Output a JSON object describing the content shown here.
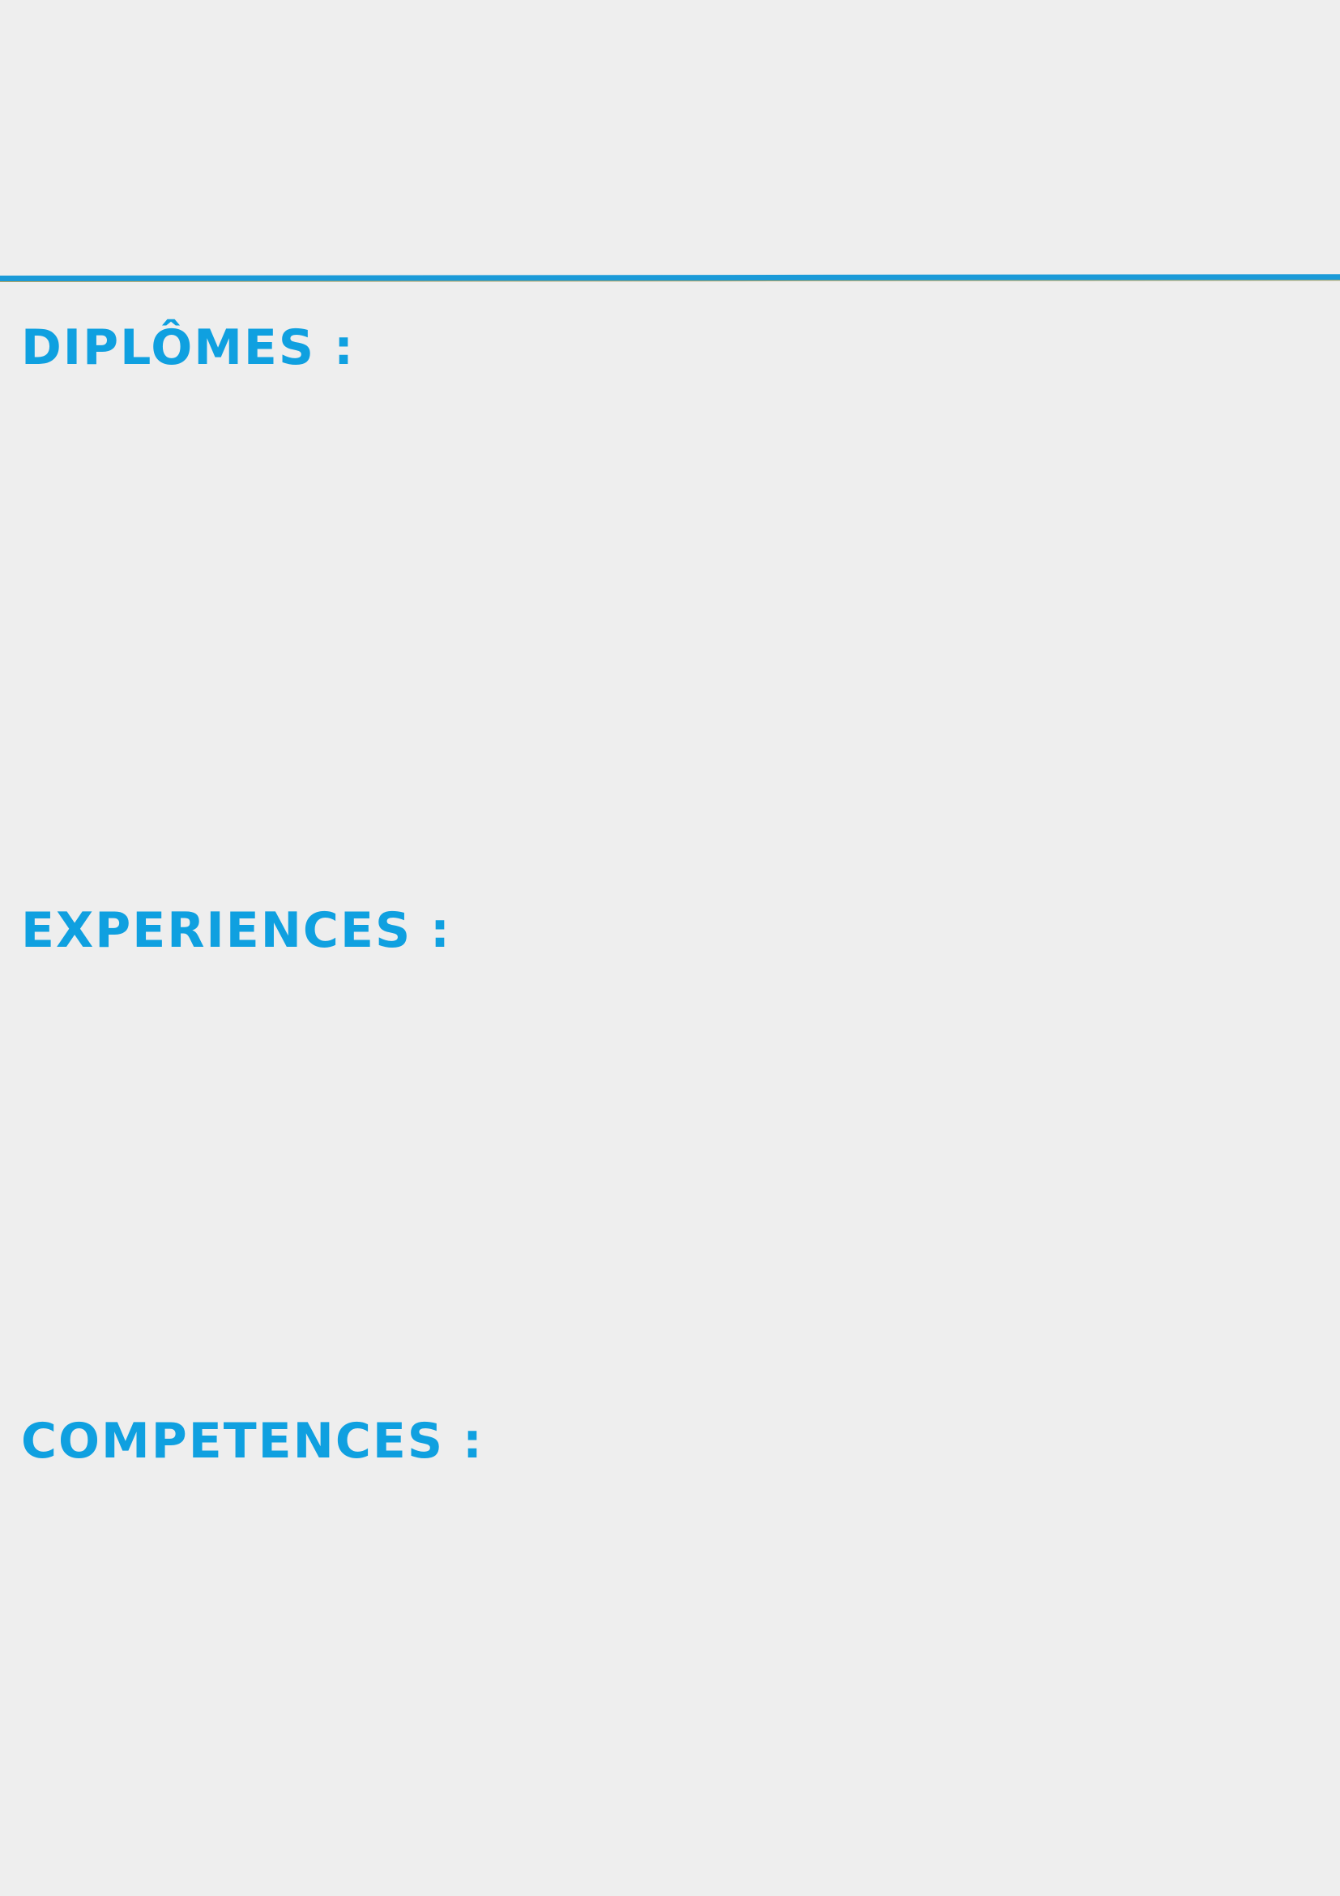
{
  "sections": {
    "diplomes": {
      "heading": "DIPLÔMES :"
    },
    "experiences": {
      "heading": "EXPERIENCES :"
    },
    "competences": {
      "heading": "COMPETENCES :"
    }
  },
  "colors": {
    "heading": "#0fa0e0",
    "divider": "#1a9ad8",
    "background": "#eeeeee"
  }
}
